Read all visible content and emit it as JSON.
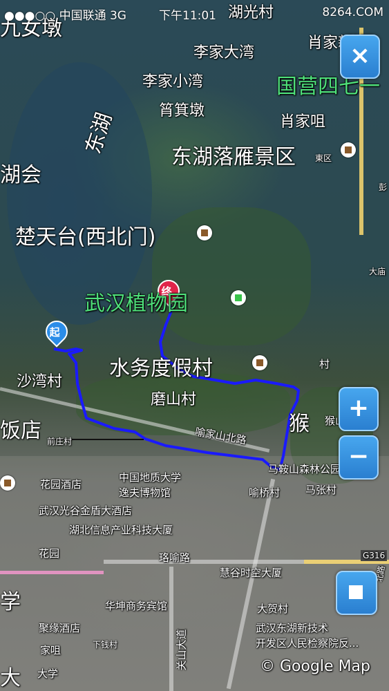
{
  "status_bar": {
    "signal": "●●●○○",
    "carrier": "中国联通",
    "network": "3G",
    "time": "下午11:01",
    "watermark": "8264.COM"
  },
  "controls": {
    "close_label": "×",
    "zoom_in_label": "+",
    "zoom_out_label": "−"
  },
  "route": {
    "start_marker": "起",
    "end_marker": "终",
    "color": "#1a1aff"
  },
  "map_labels": {
    "jiunvdun": "九女墩",
    "huguangcun": "湖光村",
    "lijiadawan": "李家大湾",
    "xiaojiaxinwan": "肖家新湾",
    "lijiaxiaowan": "李家小湾",
    "guoying": "国营四七一",
    "fenjidun": "筲箕墩",
    "xiaojiazui": "肖家咀",
    "donghu": "东湖",
    "luoyan": "东湖落雁景区",
    "hu_hui": "湖会",
    "chutiantai": "楚天台(西北门)",
    "zhiwuyuan": "武汉植物园",
    "shuiwu": "水务度假村",
    "shawancun": "沙湾村",
    "moshancun": "磨山村",
    "fandian": "饭店",
    "qianzhuangcun": "前庄村",
    "yujiashan": "喻家山北路",
    "hou": "猴",
    "houshan": "猴山",
    "luoyan_forest": "马鞍山森林公园",
    "yuqiaocun": "喻桥村",
    "majiacun": "马张村",
    "huayuan": "花园酒店",
    "dizhi": "中国地质大学",
    "yifu": "逸夫博物馆",
    "guanggu": "武汉光谷金盾大酒店",
    "hubei_xinxi": "湖北信息产业科技大厦",
    "guyuan": "花园",
    "luoyu": "珞喻路",
    "huigu": "慧谷时空大厦",
    "g316": "G316",
    "xue": "学",
    "huakun": "华坤商务宾馆",
    "dahe": "大贺村",
    "jucun": "聚缘酒店",
    "xiazhuang": "下钱村",
    "guanshan": "关山大道",
    "jiacun": "家咀",
    "gaoxin": "武汉东湖新技术",
    "jianchayuan": "开发区人民检察院反...",
    "da": "大学",
    "tai": "大",
    "yuan": "园",
    "cun": "村",
    "huali": "東区",
    "peng": "彭",
    "dati": "大庙",
    "dao": "北路",
    "copyright": "© Google Map"
  }
}
